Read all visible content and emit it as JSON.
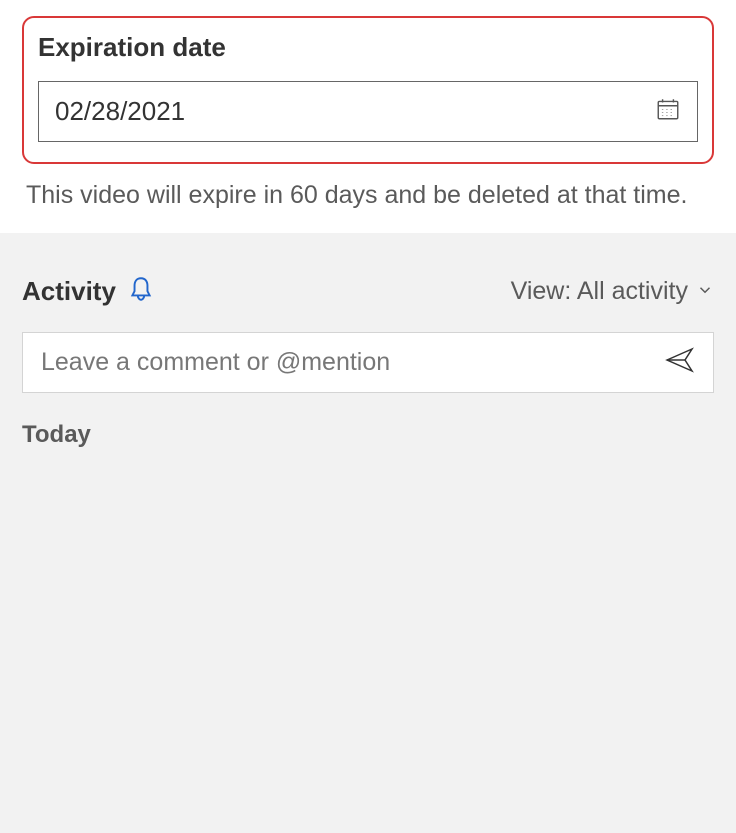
{
  "expiration": {
    "label": "Expiration date",
    "value": "02/28/2021",
    "helper_text": "This video will expire in 60 days and be deleted at that time."
  },
  "activity": {
    "title": "Activity",
    "view_label": "View: All activity",
    "comment_placeholder": "Leave a comment or @mention",
    "today_label": "Today"
  }
}
